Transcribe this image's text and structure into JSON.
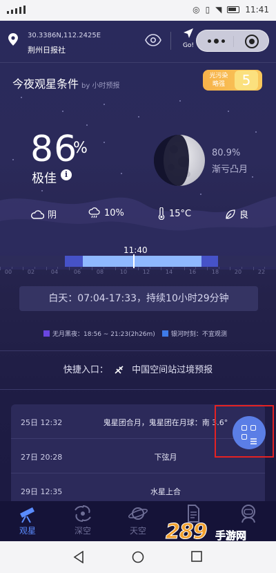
{
  "status_bar": {
    "time": "11:41"
  },
  "location": {
    "coords": "30.3386N,112.2425E",
    "place": "荆州日报社",
    "go_label": "Go!"
  },
  "header": {
    "title": "今夜观星条件",
    "subtitle": "by 小时预报",
    "light_pollution": {
      "label_line1": "光污染",
      "label_line2": "略强",
      "value": "5",
      "color": "#f7b24a"
    }
  },
  "score": {
    "value": "86",
    "unit": "%",
    "quality": "极佳",
    "info_glyph": "i"
  },
  "moon": {
    "illumination": "80.9%",
    "phase": "渐亏凸月"
  },
  "weather": [
    {
      "icon": "cloud-icon",
      "label": "阴"
    },
    {
      "icon": "rain-chance-icon",
      "label": "10%"
    },
    {
      "icon": "thermometer-icon",
      "label": "15°C"
    },
    {
      "icon": "leaf-icon",
      "label": "良"
    }
  ],
  "timeline": {
    "now": "11:40",
    "ticks": [
      "00",
      "02",
      "04",
      "06",
      "08",
      "10",
      "12",
      "14",
      "16",
      "18",
      "20",
      "22"
    ],
    "daytime_text": "白天：07:04-17:33，持续10小时29分钟",
    "colors": {
      "night": "#4652c8",
      "day": "#8fb8ff"
    }
  },
  "legend": {
    "moonless": "无月黑夜：18:56 ~ 21:23(2h26m)",
    "milky_way": "银河时刻：不宜观测",
    "moonless_color": "#6a46e0",
    "milky_way_color": "#3f7be8"
  },
  "quick_entry": {
    "label": "快捷入口：",
    "link": "中国空间站过境预报"
  },
  "events": [
    {
      "date": "25日 12:32",
      "text": "鬼星团合月，鬼星团在月球：南 3.6°"
    },
    {
      "date": "27日 20:28",
      "text": "下弦月"
    },
    {
      "date": "29日 12:35",
      "text": "水星上合"
    }
  ],
  "nav": [
    {
      "label": "观星",
      "icon": "telescope-icon",
      "active": true
    },
    {
      "label": "深空",
      "icon": "galaxy-icon",
      "active": false
    },
    {
      "label": "天空",
      "icon": "planet-icon",
      "active": false
    },
    {
      "label": "",
      "icon": "document-icon",
      "active": false
    },
    {
      "label": "",
      "icon": "astronaut-icon",
      "active": false
    }
  ],
  "watermark": {
    "number": "289",
    "text": "手游网"
  }
}
